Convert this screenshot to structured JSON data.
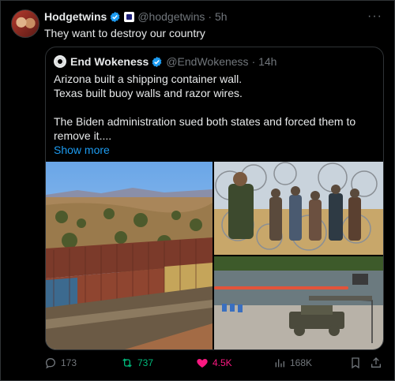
{
  "tweet": {
    "author_name": "Hodgetwins",
    "author_handle": "@hodgetwins",
    "time": "· 5h",
    "text": "They want to destroy our country",
    "more_icon": "more-icon"
  },
  "quoted_tweet": {
    "author_name": "End Wokeness",
    "author_handle": "@EndWokeness",
    "time": "· 14h",
    "lines": [
      "Arizona built a shipping container wall.",
      "Texas built buoy walls and razor wires.",
      "",
      "The Biden administration sued both states and forced them to remove it...."
    ],
    "show_more": "Show more",
    "images": [
      "shipping-container-wall-photo",
      "razor-wire-border-photo",
      "river-buoy-barrier-photo"
    ]
  },
  "actions": {
    "replies": "173",
    "reposts": "737",
    "likes": "4.5K",
    "views": "168K"
  },
  "colors": {
    "background": "#000000",
    "text": "#e7e9ea",
    "muted": "#71767b",
    "link": "#1d9bf0",
    "repost": "#00ba7c",
    "like": "#f91880"
  }
}
